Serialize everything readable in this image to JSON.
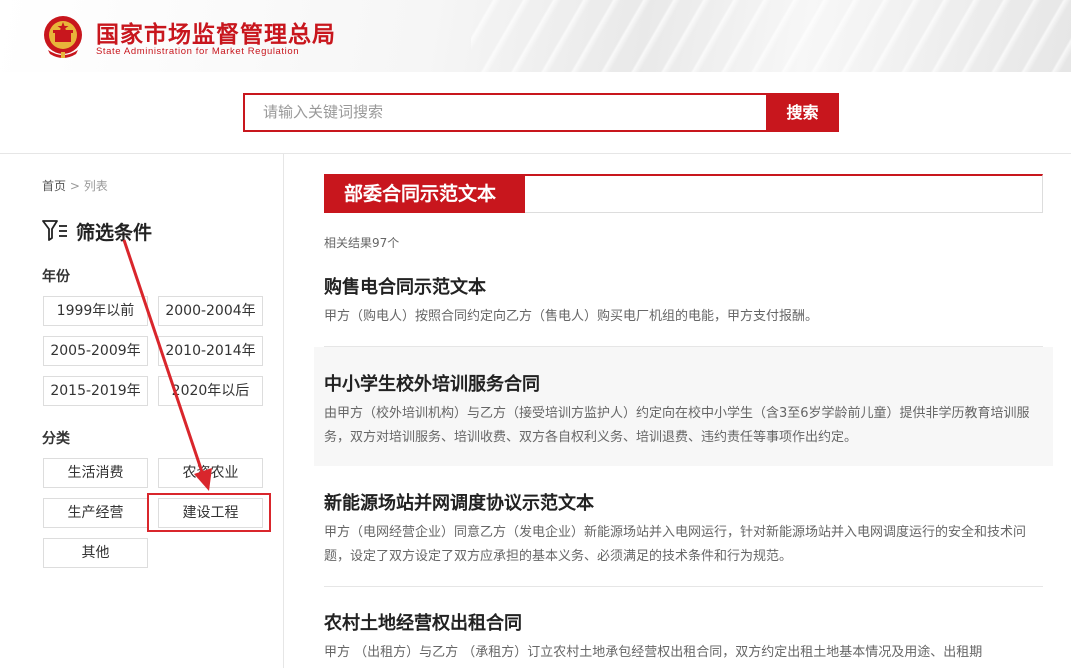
{
  "header": {
    "logo_cn": "国家市场监督管理总局",
    "logo_en": "State Administration for Market Regulation",
    "brand_color": "#c8161d"
  },
  "search": {
    "placeholder": "请输入关键词搜索",
    "button_label": "搜索"
  },
  "sidebar": {
    "breadcrumb": {
      "home": "首页",
      "separator": ">",
      "current": "列表"
    },
    "filter_title": "筛选条件",
    "year_group": {
      "title": "年份",
      "options": [
        "1999年以前",
        "2000-2004年",
        "2005-2009年",
        "2010-2014年",
        "2015-2019年",
        "2020年以后"
      ]
    },
    "category_group": {
      "title": "分类",
      "options": [
        "生活消费",
        "农资农业",
        "生产经营",
        "建设工程",
        "其他"
      ],
      "highlighted": "建设工程"
    },
    "annotation_color": "#d9262c"
  },
  "main": {
    "category_tab": "部委合同示范文本",
    "result_count": "相关结果97个",
    "items": [
      {
        "title": "购售电合同示范文本",
        "desc": "甲方（购电人）按照合同约定向乙方（售电人）购买电厂机组的电能，甲方支付报酬。"
      },
      {
        "title": "中小学生校外培训服务合同",
        "desc": "由甲方（校外培训机构）与乙方（接受培训方监护人）约定向在校中小学生（含3至6岁学龄前儿童）提供非学历教育培训服务，双方对培训服务、培训收费、双方各自权利义务、培训退费、违约责任等事项作出约定。"
      },
      {
        "title": "新能源场站并网调度协议示范文本",
        "desc": "甲方（电网经营企业）同意乙方（发电企业）新能源场站并入电网运行，针对新能源场站并入电网调度运行的安全和技术问题，设定了双方设定了双方应承担的基本义务、必须满足的技术条件和行为规范。"
      },
      {
        "title": "农村土地经营权出租合同",
        "desc": "甲方 （出租方）与乙方 （承租方）订立农村土地承包经营权出租合同，双方约定出租土地基本情况及用途、出租期"
      }
    ]
  }
}
